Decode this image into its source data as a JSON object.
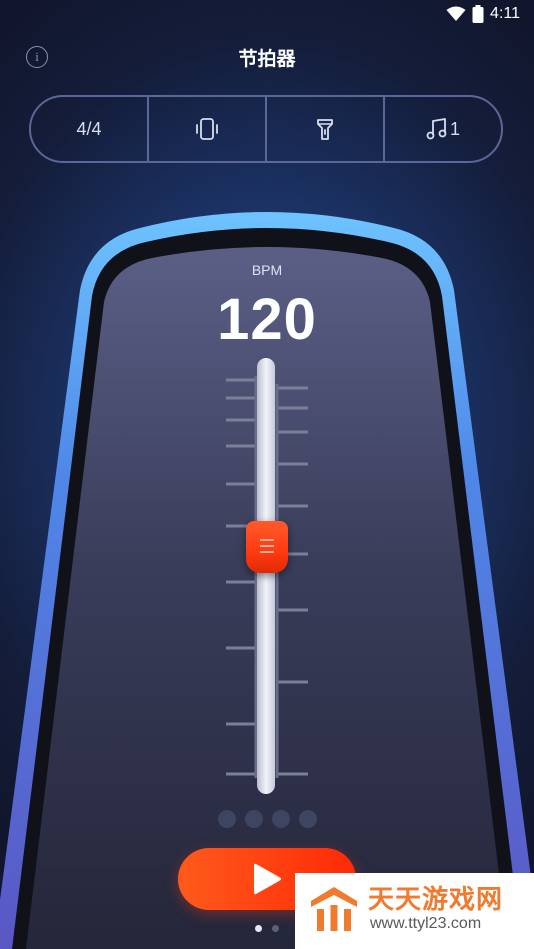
{
  "status_bar": {
    "time": "4:11",
    "icons": [
      "wifi-icon",
      "battery-icon"
    ]
  },
  "header": {
    "title": "节拍器",
    "info_icon": "info-icon",
    "info_glyph": "i"
  },
  "toolbar": {
    "time_signature": "4/4",
    "vibrate_icon": "vibrate-icon",
    "flashlight_icon": "flashlight-icon",
    "sound_icon": "music-note-icon",
    "sound_value": "1"
  },
  "metronome": {
    "bpm_label": "BPM",
    "bpm_value": "120",
    "beat_count": 4
  },
  "controls": {
    "play_icon": "play-icon",
    "page_count": 2,
    "active_page": 1
  },
  "watermark": {
    "title": "天天游戏网",
    "url": "www.ttyl23.com"
  },
  "colors": {
    "accent": "#ff3a10",
    "frame_glow": "#5fb0ff",
    "background": "#141d3a",
    "text": "#ffffff"
  }
}
